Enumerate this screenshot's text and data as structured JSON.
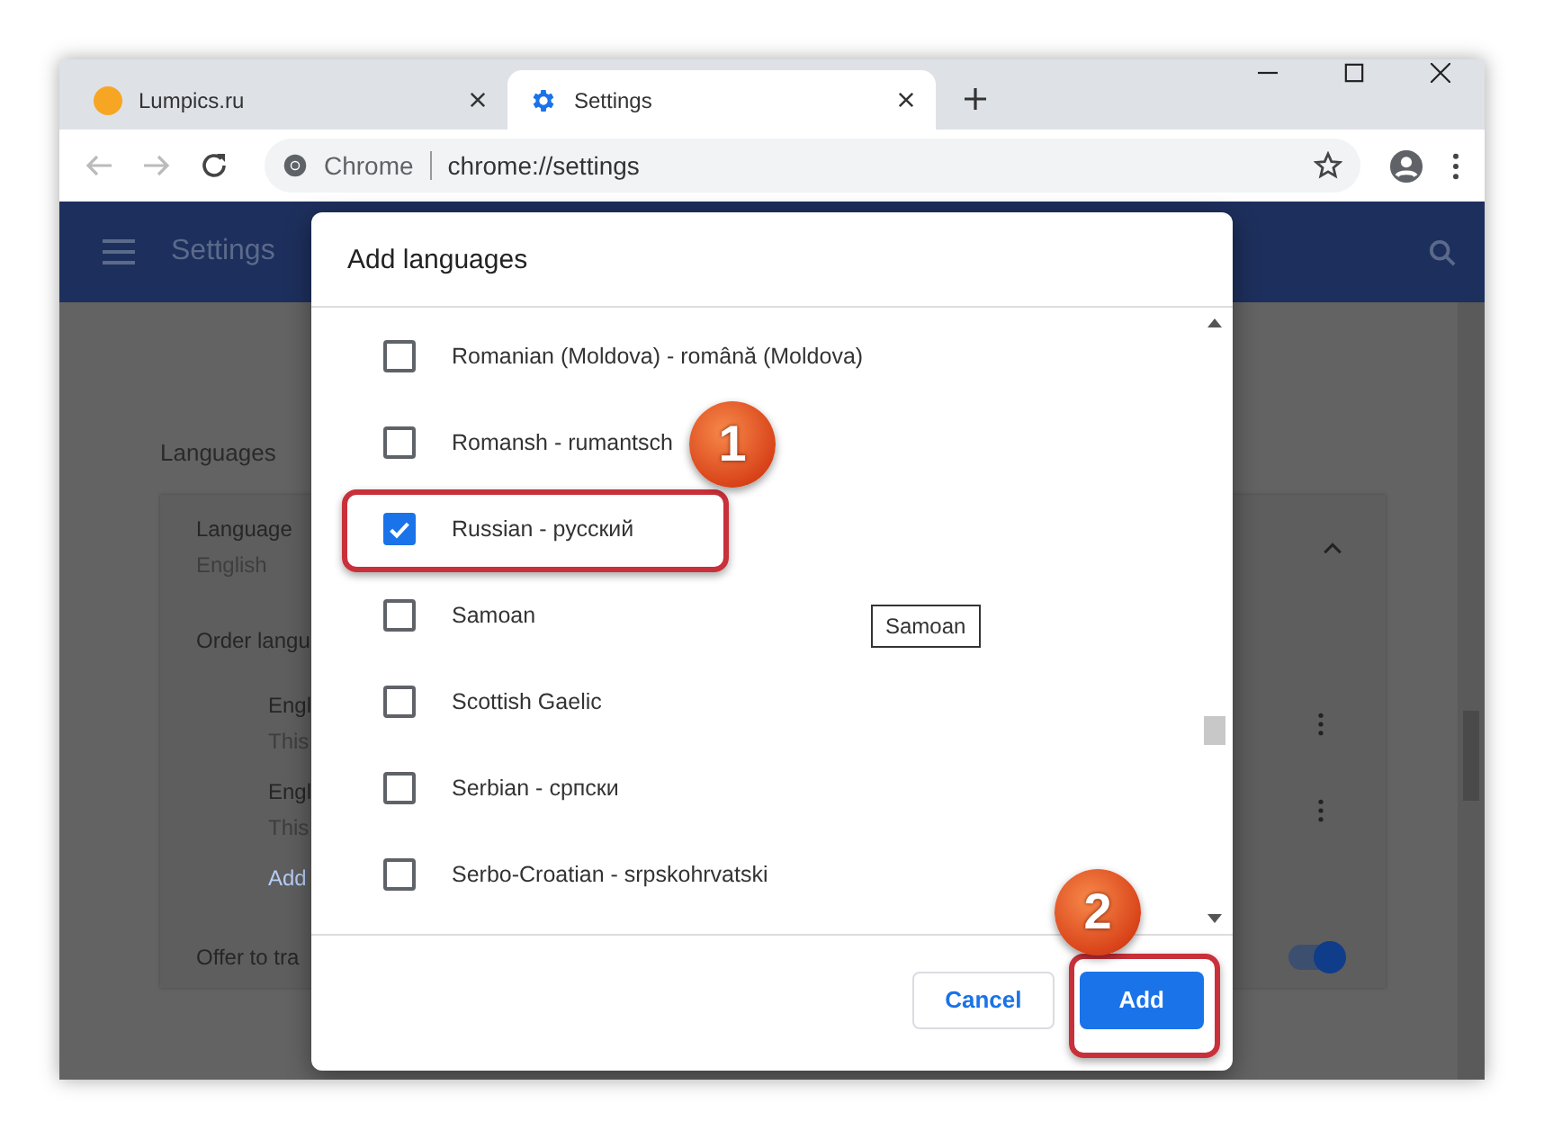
{
  "tabs": [
    {
      "title": "Lumpics.ru",
      "kind": "site",
      "selected": false
    },
    {
      "title": "Settings",
      "kind": "settings",
      "selected": true
    }
  ],
  "address_bar": {
    "site_label": "Chrome",
    "url": "chrome://settings"
  },
  "settings_header": {
    "title": "Settings"
  },
  "languages_section": {
    "heading": "Languages",
    "language_label": "Language",
    "language_value": "English",
    "order_label": "Order langu",
    "entries": [
      {
        "name": "Engl",
        "note": "This"
      },
      {
        "name": "Engl",
        "note": "This"
      }
    ],
    "add_link": "Add",
    "offer_label": "Offer to tra",
    "offer_toggle_on": true
  },
  "dialog": {
    "title": "Add languages",
    "languages": [
      {
        "name": "Romanian (Moldova) - română (Moldova)",
        "checked": false
      },
      {
        "name": "Romansh - rumantsch",
        "checked": false
      },
      {
        "name": "Russian - русский",
        "checked": true
      },
      {
        "name": "Samoan",
        "checked": false
      },
      {
        "name": "Scottish Gaelic",
        "checked": false
      },
      {
        "name": "Serbian - српски",
        "checked": false
      },
      {
        "name": "Serbo-Croatian - srpskohrvatski",
        "checked": false
      }
    ],
    "tooltip": "Samoan",
    "cancel_button": "Cancel",
    "add_button": "Add"
  },
  "callouts": [
    {
      "number": "1"
    },
    {
      "number": "2"
    }
  ]
}
